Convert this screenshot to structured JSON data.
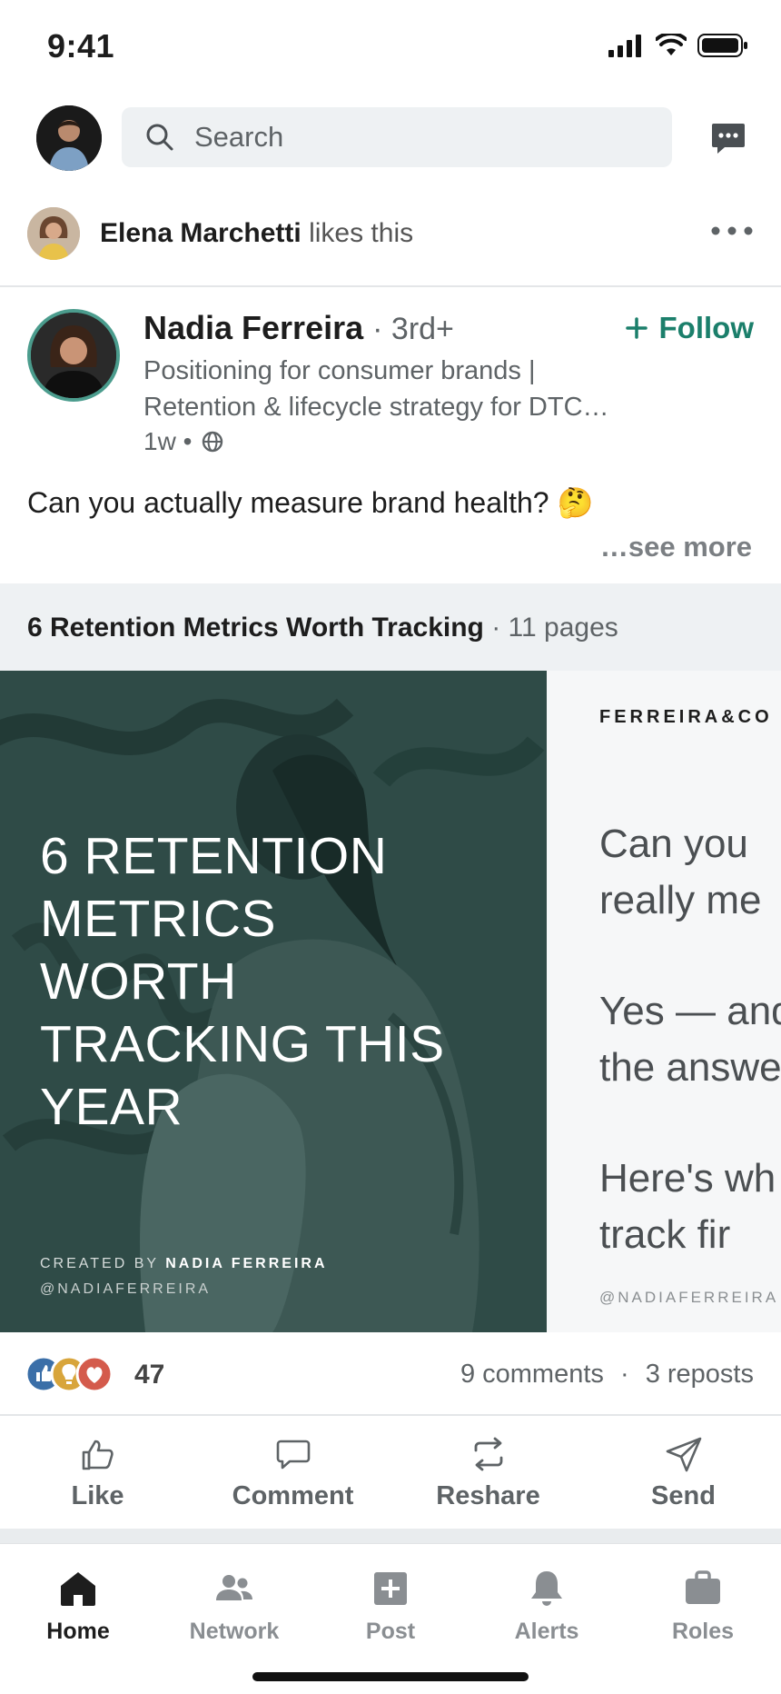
{
  "status_bar": {
    "time": "9:41"
  },
  "search": {
    "placeholder": "Search"
  },
  "social_context": {
    "actor": "Elena Marchetti",
    "action": "likes this"
  },
  "post": {
    "author_name": "Nadia Ferreira",
    "degree": "· 3rd+",
    "headline": "Positioning for consumer brands | Retention & lifecycle strategy for DTC…",
    "time": "1w •",
    "follow_label": "Follow",
    "text": "Can you actually measure brand health? 🤔",
    "see_more": "…see more"
  },
  "document": {
    "title": "6 Retention Metrics Worth Tracking",
    "pages": "· 11 pages",
    "slide1": {
      "headline": "6 RETENTION METRICS WORTH TRACKING THIS YEAR",
      "credit_prefix": "CREATED BY",
      "credit_name": "NADIA FERREIRA",
      "handle": "@NADIAFERREIRA"
    },
    "slide2": {
      "brand": "FERREIRA&CO",
      "para1_line1": "Can you",
      "para1_line2": "really me",
      "para2_line1": "Yes — and",
      "para2_line2": "the answe",
      "para3_line1": "Here's wh",
      "para3_line2": "track fir",
      "handle": "@NADIAFERREIRA"
    }
  },
  "engagement": {
    "reaction_count": "47",
    "comments": "9 comments",
    "separator": "·",
    "reposts": "3 reposts"
  },
  "actions": {
    "like": "Like",
    "comment": "Comment",
    "reshare": "Reshare",
    "send": "Send"
  },
  "bottom_nav": {
    "home": "Home",
    "network": "Network",
    "post": "Post",
    "alerts": "Alerts",
    "roles": "Roles"
  },
  "colors": {
    "accent": "#1b7f6b",
    "slide_bg": "#2e4a46",
    "like_blue": "#3b6fa8",
    "celebrate_yellow": "#d8a53b",
    "love_red": "#d45b4c"
  },
  "icons": {
    "search": "search-icon",
    "messages": "message-icon",
    "more": "more-horizontal-icon",
    "globe": "globe-icon",
    "follow": "plus-icon"
  }
}
